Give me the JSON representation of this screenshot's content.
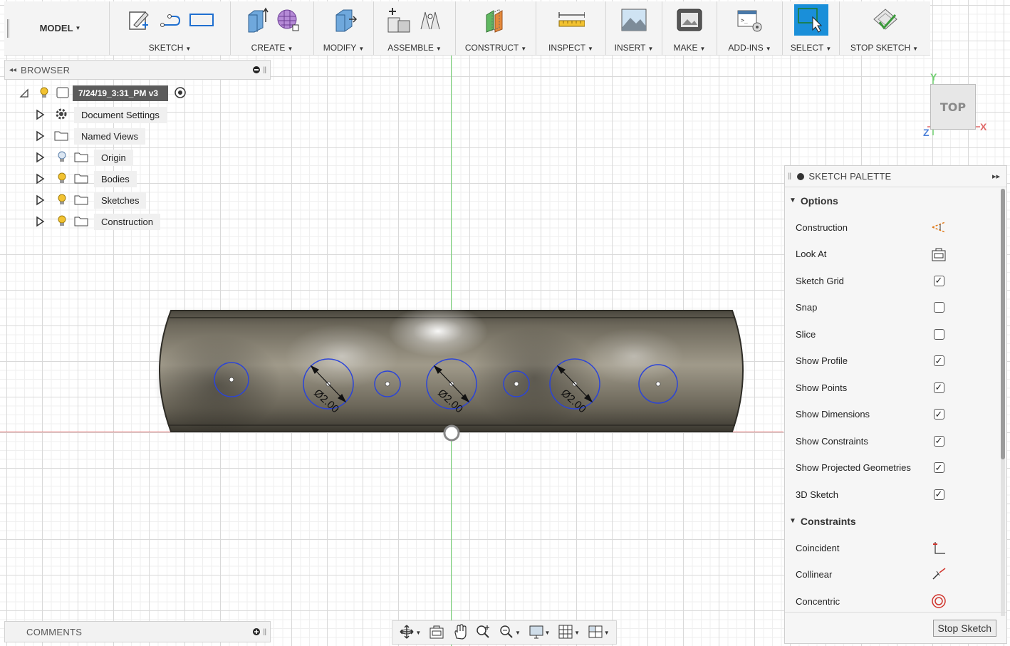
{
  "toolbar": {
    "workspace": "MODEL",
    "groups": [
      {
        "label": "SKETCH",
        "icons": [
          "create-sketch-icon",
          "spline-icon",
          "rectangle-icon"
        ]
      },
      {
        "label": "CREATE",
        "icons": [
          "extrude-icon",
          "form-icon"
        ]
      },
      {
        "label": "MODIFY",
        "icons": [
          "press-pull-icon"
        ]
      },
      {
        "label": "ASSEMBLE",
        "icons": [
          "new-component-icon",
          "joint-icon"
        ]
      },
      {
        "label": "CONSTRUCT",
        "icons": [
          "offset-plane-icon"
        ]
      },
      {
        "label": "INSPECT",
        "icons": [
          "measure-icon"
        ]
      },
      {
        "label": "INSERT",
        "icons": [
          "insert-image-icon"
        ]
      },
      {
        "label": "MAKE",
        "icons": [
          "3d-print-icon"
        ]
      },
      {
        "label": "ADD-INS",
        "icons": [
          "scripts-icon"
        ]
      },
      {
        "label": "SELECT",
        "icons": [
          "select-icon"
        ]
      },
      {
        "label": "STOP SKETCH",
        "icons": [
          "finish-sketch-icon"
        ]
      }
    ]
  },
  "browser": {
    "title": "BROWSER",
    "document": "7/24/19_3:31_PM v3",
    "items": [
      {
        "label": "Document Settings"
      },
      {
        "label": "Named Views"
      },
      {
        "label": "Origin"
      },
      {
        "label": "Bodies"
      },
      {
        "label": "Sketches"
      },
      {
        "label": "Construction"
      }
    ]
  },
  "viewcube": {
    "face": "TOP",
    "axis_x": "X",
    "axis_y": "Y",
    "axis_z": "Z"
  },
  "dimensions": [
    "Ø2.00",
    "Ø2.00",
    "Ø2.00"
  ],
  "palette": {
    "title": "SKETCH PALETTE",
    "options_header": "Options",
    "options": [
      {
        "label": "Construction",
        "control": "icon",
        "icon": "construction-line-icon"
      },
      {
        "label": "Look At",
        "control": "icon",
        "icon": "look-at-icon"
      },
      {
        "label": "Sketch Grid",
        "control": "checkbox",
        "checked": true
      },
      {
        "label": "Snap",
        "control": "checkbox",
        "checked": false
      },
      {
        "label": "Slice",
        "control": "checkbox",
        "checked": false
      },
      {
        "label": "Show Profile",
        "control": "checkbox",
        "checked": true
      },
      {
        "label": "Show Points",
        "control": "checkbox",
        "checked": true
      },
      {
        "label": "Show Dimensions",
        "control": "checkbox",
        "checked": true
      },
      {
        "label": "Show Constraints",
        "control": "checkbox",
        "checked": true
      },
      {
        "label": "Show Projected Geometries",
        "control": "checkbox",
        "checked": true
      },
      {
        "label": "3D Sketch",
        "control": "checkbox",
        "checked": true
      }
    ],
    "constraints_header": "Constraints",
    "constraints": [
      {
        "label": "Coincident",
        "icon": "coincident-icon"
      },
      {
        "label": "Collinear",
        "icon": "collinear-icon"
      },
      {
        "label": "Concentric",
        "icon": "concentric-icon"
      }
    ],
    "stop_button": "Stop Sketch"
  },
  "comments": {
    "title": "COMMENTS"
  },
  "colors": {
    "select_active": "#1a8fd9",
    "sketch_blue": "#2b44d8",
    "axis_green": "#6fcf6f",
    "axis_red": "#e06a6a",
    "light_on": "#f2c230"
  }
}
